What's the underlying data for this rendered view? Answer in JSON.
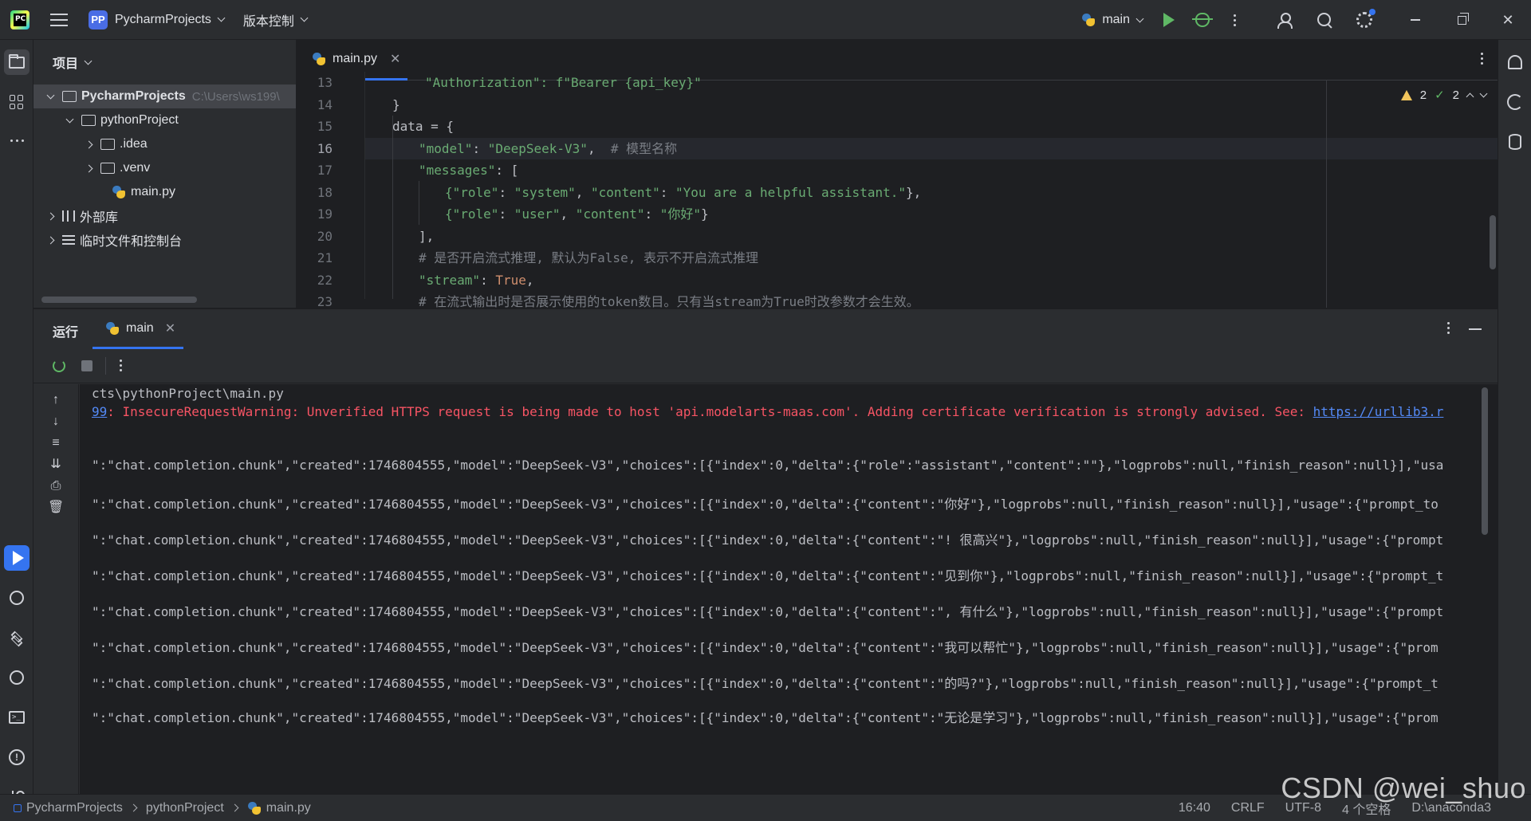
{
  "titlebar": {
    "app_logo_text": "PC",
    "project_badge": "PP",
    "project_name": "PycharmProjects",
    "vcs_label": "版本控制",
    "run_config": "main"
  },
  "project_panel": {
    "title": "项目",
    "tree": [
      {
        "label": "PycharmProjects",
        "hint": "C:\\Users\\ws199\\",
        "level": 0,
        "expanded": true,
        "icon": "folder-icon",
        "bold": true
      },
      {
        "label": "pythonProject",
        "level": 1,
        "expanded": true,
        "icon": "folder-icon"
      },
      {
        "label": ".idea",
        "level": 2,
        "expanded": false,
        "icon": "folder-icon"
      },
      {
        "label": ".venv",
        "level": 2,
        "expanded": false,
        "icon": "folder-icon"
      },
      {
        "label": "main.py",
        "level": 2,
        "icon": "python-file-icon"
      },
      {
        "label": "外部库",
        "level": 0,
        "expanded": false,
        "icon": "library-icon"
      },
      {
        "label": "临时文件和控制台",
        "level": 0,
        "expanded": false,
        "icon": "scratches-icon"
      }
    ]
  },
  "editor": {
    "tab_label": "main.py",
    "inspections": {
      "warnings": "2",
      "ok": "2"
    },
    "current_line": 16,
    "line_numbers": [
      "13",
      "14",
      "15",
      "16",
      "17",
      "18",
      "19",
      "20",
      "21",
      "22",
      "23"
    ],
    "lines": {
      "l13": "\"Authorization\": f\"Bearer {api_key}\"",
      "l14": "}",
      "l15": "data = {",
      "l16_key": "\"model\"",
      "l16_val": "\"DeepSeek-V3\"",
      "l16_comment": "# 模型名称",
      "l17_key": "\"messages\"",
      "l18_a": "{\"role\"",
      "l18_b": "\"system\"",
      "l18_c": "\"content\"",
      "l18_d": "\"You are a helpful assistant.\"",
      "l19_a": "{\"role\"",
      "l19_b": "\"user\"",
      "l19_c": "\"content\"",
      "l19_d": "\"你好\"",
      "l20": "],",
      "l21": "# 是否开启流式推理, 默认为False, 表示不开启流式推理",
      "l22_key": "\"stream\"",
      "l22_val": "True",
      "l23": "# 在流式输出时是否展示使用的token数目。只有当stream为True时改参数才会生效。"
    }
  },
  "run_panel": {
    "title": "运行",
    "tab_label": "main",
    "console": {
      "line1": "cts\\pythonProject\\main.py",
      "warn_prefix": "99",
      "warn_text": ": InsecureRequestWarning: Unverified HTTPS request is being made to host 'api.modelarts-maas.com'. Adding certificate verification is strongly advised. See: ",
      "warn_link": "https://urllib3.r",
      "chunks": [
        "\":\"chat.completion.chunk\",\"created\":1746804555,\"model\":\"DeepSeek-V3\",\"choices\":[{\"index\":0,\"delta\":{\"role\":\"assistant\",\"content\":\"\"},\"logprobs\":null,\"finish_reason\":null}],\"usa",
        "\":\"chat.completion.chunk\",\"created\":1746804555,\"model\":\"DeepSeek-V3\",\"choices\":[{\"index\":0,\"delta\":{\"content\":\"你好\"},\"logprobs\":null,\"finish_reason\":null}],\"usage\":{\"prompt_to",
        "\":\"chat.completion.chunk\",\"created\":1746804555,\"model\":\"DeepSeek-V3\",\"choices\":[{\"index\":0,\"delta\":{\"content\":\"! 很高兴\"},\"logprobs\":null,\"finish_reason\":null}],\"usage\":{\"prompt",
        "\":\"chat.completion.chunk\",\"created\":1746804555,\"model\":\"DeepSeek-V3\",\"choices\":[{\"index\":0,\"delta\":{\"content\":\"见到你\"},\"logprobs\":null,\"finish_reason\":null}],\"usage\":{\"prompt_t",
        "\":\"chat.completion.chunk\",\"created\":1746804555,\"model\":\"DeepSeek-V3\",\"choices\":[{\"index\":0,\"delta\":{\"content\":\", 有什么\"},\"logprobs\":null,\"finish_reason\":null}],\"usage\":{\"prompt",
        "\":\"chat.completion.chunk\",\"created\":1746804555,\"model\":\"DeepSeek-V3\",\"choices\":[{\"index\":0,\"delta\":{\"content\":\"我可以帮忙\"},\"logprobs\":null,\"finish_reason\":null}],\"usage\":{\"prom",
        "\":\"chat.completion.chunk\",\"created\":1746804555,\"model\":\"DeepSeek-V3\",\"choices\":[{\"index\":0,\"delta\":{\"content\":\"的吗?\"},\"logprobs\":null,\"finish_reason\":null}],\"usage\":{\"prompt_t",
        "\":\"chat.completion.chunk\",\"created\":1746804555,\"model\":\"DeepSeek-V3\",\"choices\":[{\"index\":0,\"delta\":{\"content\":\"无论是学习\"},\"logprobs\":null,\"finish_reason\":null}],\"usage\":{\"prom"
      ]
    }
  },
  "statusbar": {
    "crumbs": [
      "PycharmProjects",
      "pythonProject",
      "main.py"
    ],
    "position": "16:40",
    "line_sep": "CRLF",
    "encoding": "UTF-8",
    "indent": "4 个空格",
    "interpreter": "D:\\anaconda3"
  },
  "watermark": "CSDN @wei_shuo",
  "colors": {
    "accent": "#3574f0",
    "run_green": "#5fb865",
    "string_green": "#6aab73",
    "keyword_orange": "#cf8e6d",
    "error_red": "#f75464",
    "warning_yellow": "#f2c55c"
  }
}
